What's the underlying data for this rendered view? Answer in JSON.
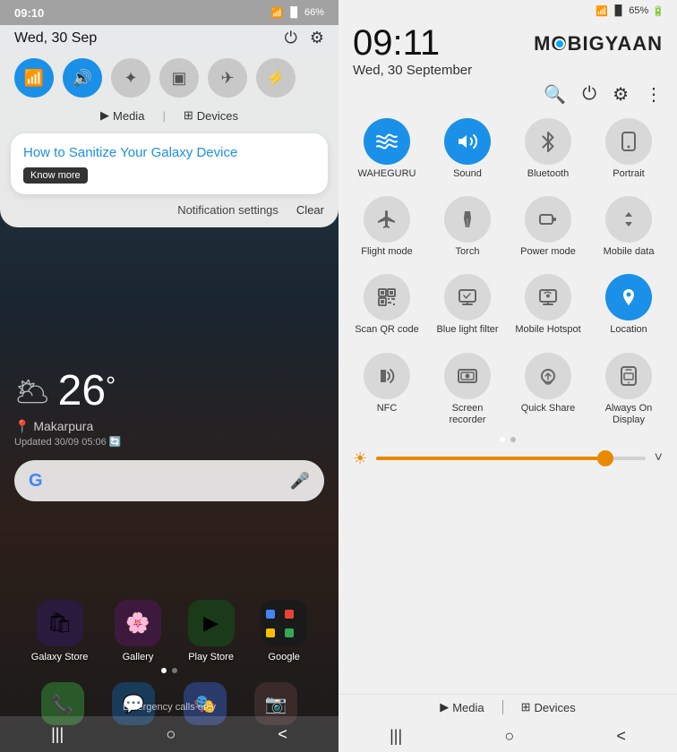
{
  "left": {
    "status_bar": {
      "time": "09:10",
      "signal": "📶",
      "battery": "66%"
    },
    "header": {
      "date": "Wed, 30 Sep",
      "power_icon": "⏻",
      "settings_icon": "⚙"
    },
    "toggles": [
      {
        "id": "wifi",
        "icon": "📶",
        "active": true
      },
      {
        "id": "sound",
        "icon": "🔊",
        "active": true
      },
      {
        "id": "bluetooth",
        "icon": "🔵",
        "active": false
      },
      {
        "id": "storage",
        "icon": "💾",
        "active": false
      },
      {
        "id": "airplane",
        "icon": "✈",
        "active": false
      },
      {
        "id": "torch",
        "icon": "🔦",
        "active": false
      }
    ],
    "media_label": "Media",
    "devices_label": "Devices",
    "notification": {
      "title": "How to Sanitize Your",
      "title_highlight": "Galaxy Device",
      "know_more": "Know more"
    },
    "notif_settings": "Notification settings",
    "clear": "Clear",
    "weather": {
      "icon": "🌥",
      "temp": "26",
      "unit": "°",
      "location": "📍 Makarpura",
      "updated": "Updated 30/09 05:06 🔄"
    },
    "apps_row1": [
      {
        "label": "Galaxy Store",
        "icon": "🛍",
        "color": "#1a1a2e"
      },
      {
        "label": "Gallery",
        "icon": "🌸",
        "color": "#2d1b2e"
      },
      {
        "label": "Play Store",
        "icon": "▶",
        "color": "#1a2a1a"
      },
      {
        "label": "Google",
        "icon": "G",
        "color": "#2a2a1a"
      }
    ],
    "apps_row2": [
      {
        "icon": "📞",
        "color": "#2a5a2a"
      },
      {
        "icon": "💬",
        "color": "#1a3a5a"
      },
      {
        "icon": "🎭",
        "color": "#2a3a5a"
      },
      {
        "icon": "📷",
        "color": "#3a2a2a"
      }
    ],
    "emergency": "Emergency calls only",
    "nav": [
      "|||",
      "○",
      "<"
    ]
  },
  "right": {
    "status_bar": {
      "signal": "WiFi",
      "bars": "📶",
      "battery": "65%"
    },
    "time": "09:11",
    "date": "Wed, 30 September",
    "brand": "MOBIGYAAN",
    "header_icons": {
      "search": "🔍",
      "power": "⏻",
      "settings": "⚙",
      "more": "⋮"
    },
    "qs_items": [
      {
        "label": "WAHEGURU",
        "icon": "📶",
        "active": true
      },
      {
        "label": "Sound",
        "icon": "🔊",
        "active": true
      },
      {
        "label": "Bluetooth",
        "icon": "B",
        "active": false
      },
      {
        "label": "Portrait",
        "icon": "▭",
        "active": false
      },
      {
        "label": "Flight mode",
        "icon": "✈",
        "active": false
      },
      {
        "label": "Torch",
        "icon": "⚡",
        "active": false
      },
      {
        "label": "Power mode",
        "icon": "⚡",
        "active": false
      },
      {
        "label": "Mobile data",
        "icon": "↕",
        "active": false
      },
      {
        "label": "Scan QR code",
        "icon": "⬛",
        "active": false
      },
      {
        "label": "Blue light filter",
        "icon": "B",
        "active": false
      },
      {
        "label": "Mobile Hotspot",
        "icon": "B",
        "active": false
      },
      {
        "label": "Location",
        "icon": "📍",
        "active": true
      },
      {
        "label": "NFC",
        "icon": "N",
        "active": false
      },
      {
        "label": "Screen recorder",
        "icon": "⊞",
        "active": false
      },
      {
        "label": "Quick Share",
        "icon": "🔄",
        "active": false
      },
      {
        "label": "Always On Display",
        "icon": "⬛",
        "active": false
      }
    ],
    "brightness": {
      "value": 85,
      "icon": "☀"
    },
    "media_label": "Media",
    "devices_label": "Devices",
    "nav": [
      "|||",
      "○",
      "<"
    ]
  }
}
